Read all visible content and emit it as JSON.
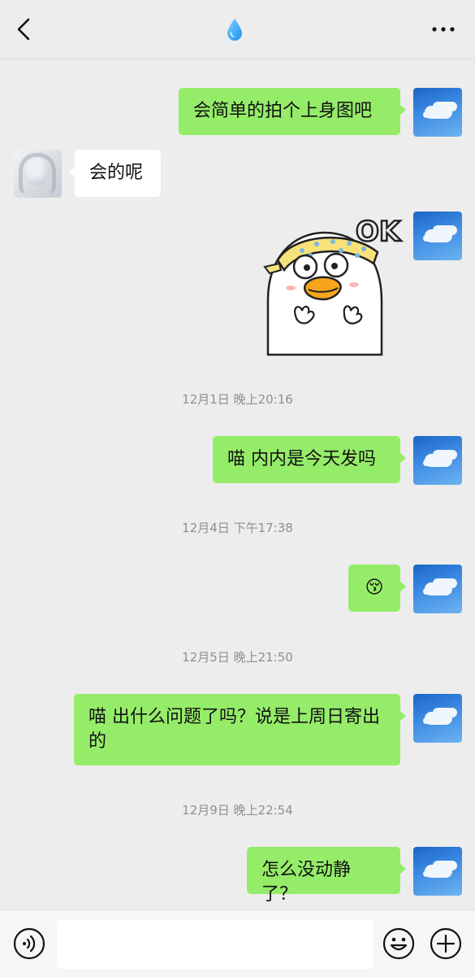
{
  "header": {
    "back_icon": "chevron-left-icon",
    "title_icon": "water-drop-icon",
    "more_icon": "more-dots-icon"
  },
  "messages": [
    {
      "side": "me",
      "text": "会简单的拍个上身图吧"
    },
    {
      "side": "other",
      "text": "会的呢"
    },
    {
      "side": "me",
      "type": "sticker",
      "sticker_text": "OK"
    },
    {
      "type": "timestamp",
      "text": "12月1日 晚上20:16"
    },
    {
      "side": "me",
      "text": "喵 内内是今天发吗"
    },
    {
      "type": "timestamp",
      "text": "12月4日 下午17:38"
    },
    {
      "side": "me",
      "type": "emoji",
      "emoji": "😚"
    },
    {
      "type": "timestamp",
      "text": "12月5日 晚上21:50"
    },
    {
      "side": "me",
      "text": "喵 出什么问题了吗？说是上周日寄出的"
    },
    {
      "type": "timestamp",
      "text": "12月9日 晚上22:54"
    },
    {
      "side": "me",
      "text": "怎么没动静了？"
    }
  ],
  "inputbar": {
    "voice_icon": "voice-icon",
    "input_value": "",
    "emoji_icon": "emoji-icon",
    "plus_icon": "plus-icon"
  },
  "colors": {
    "background": "#ededed",
    "my_bubble": "#95ec69",
    "other_bubble": "#ffffff",
    "timestamp_text": "#8f8f8f"
  }
}
